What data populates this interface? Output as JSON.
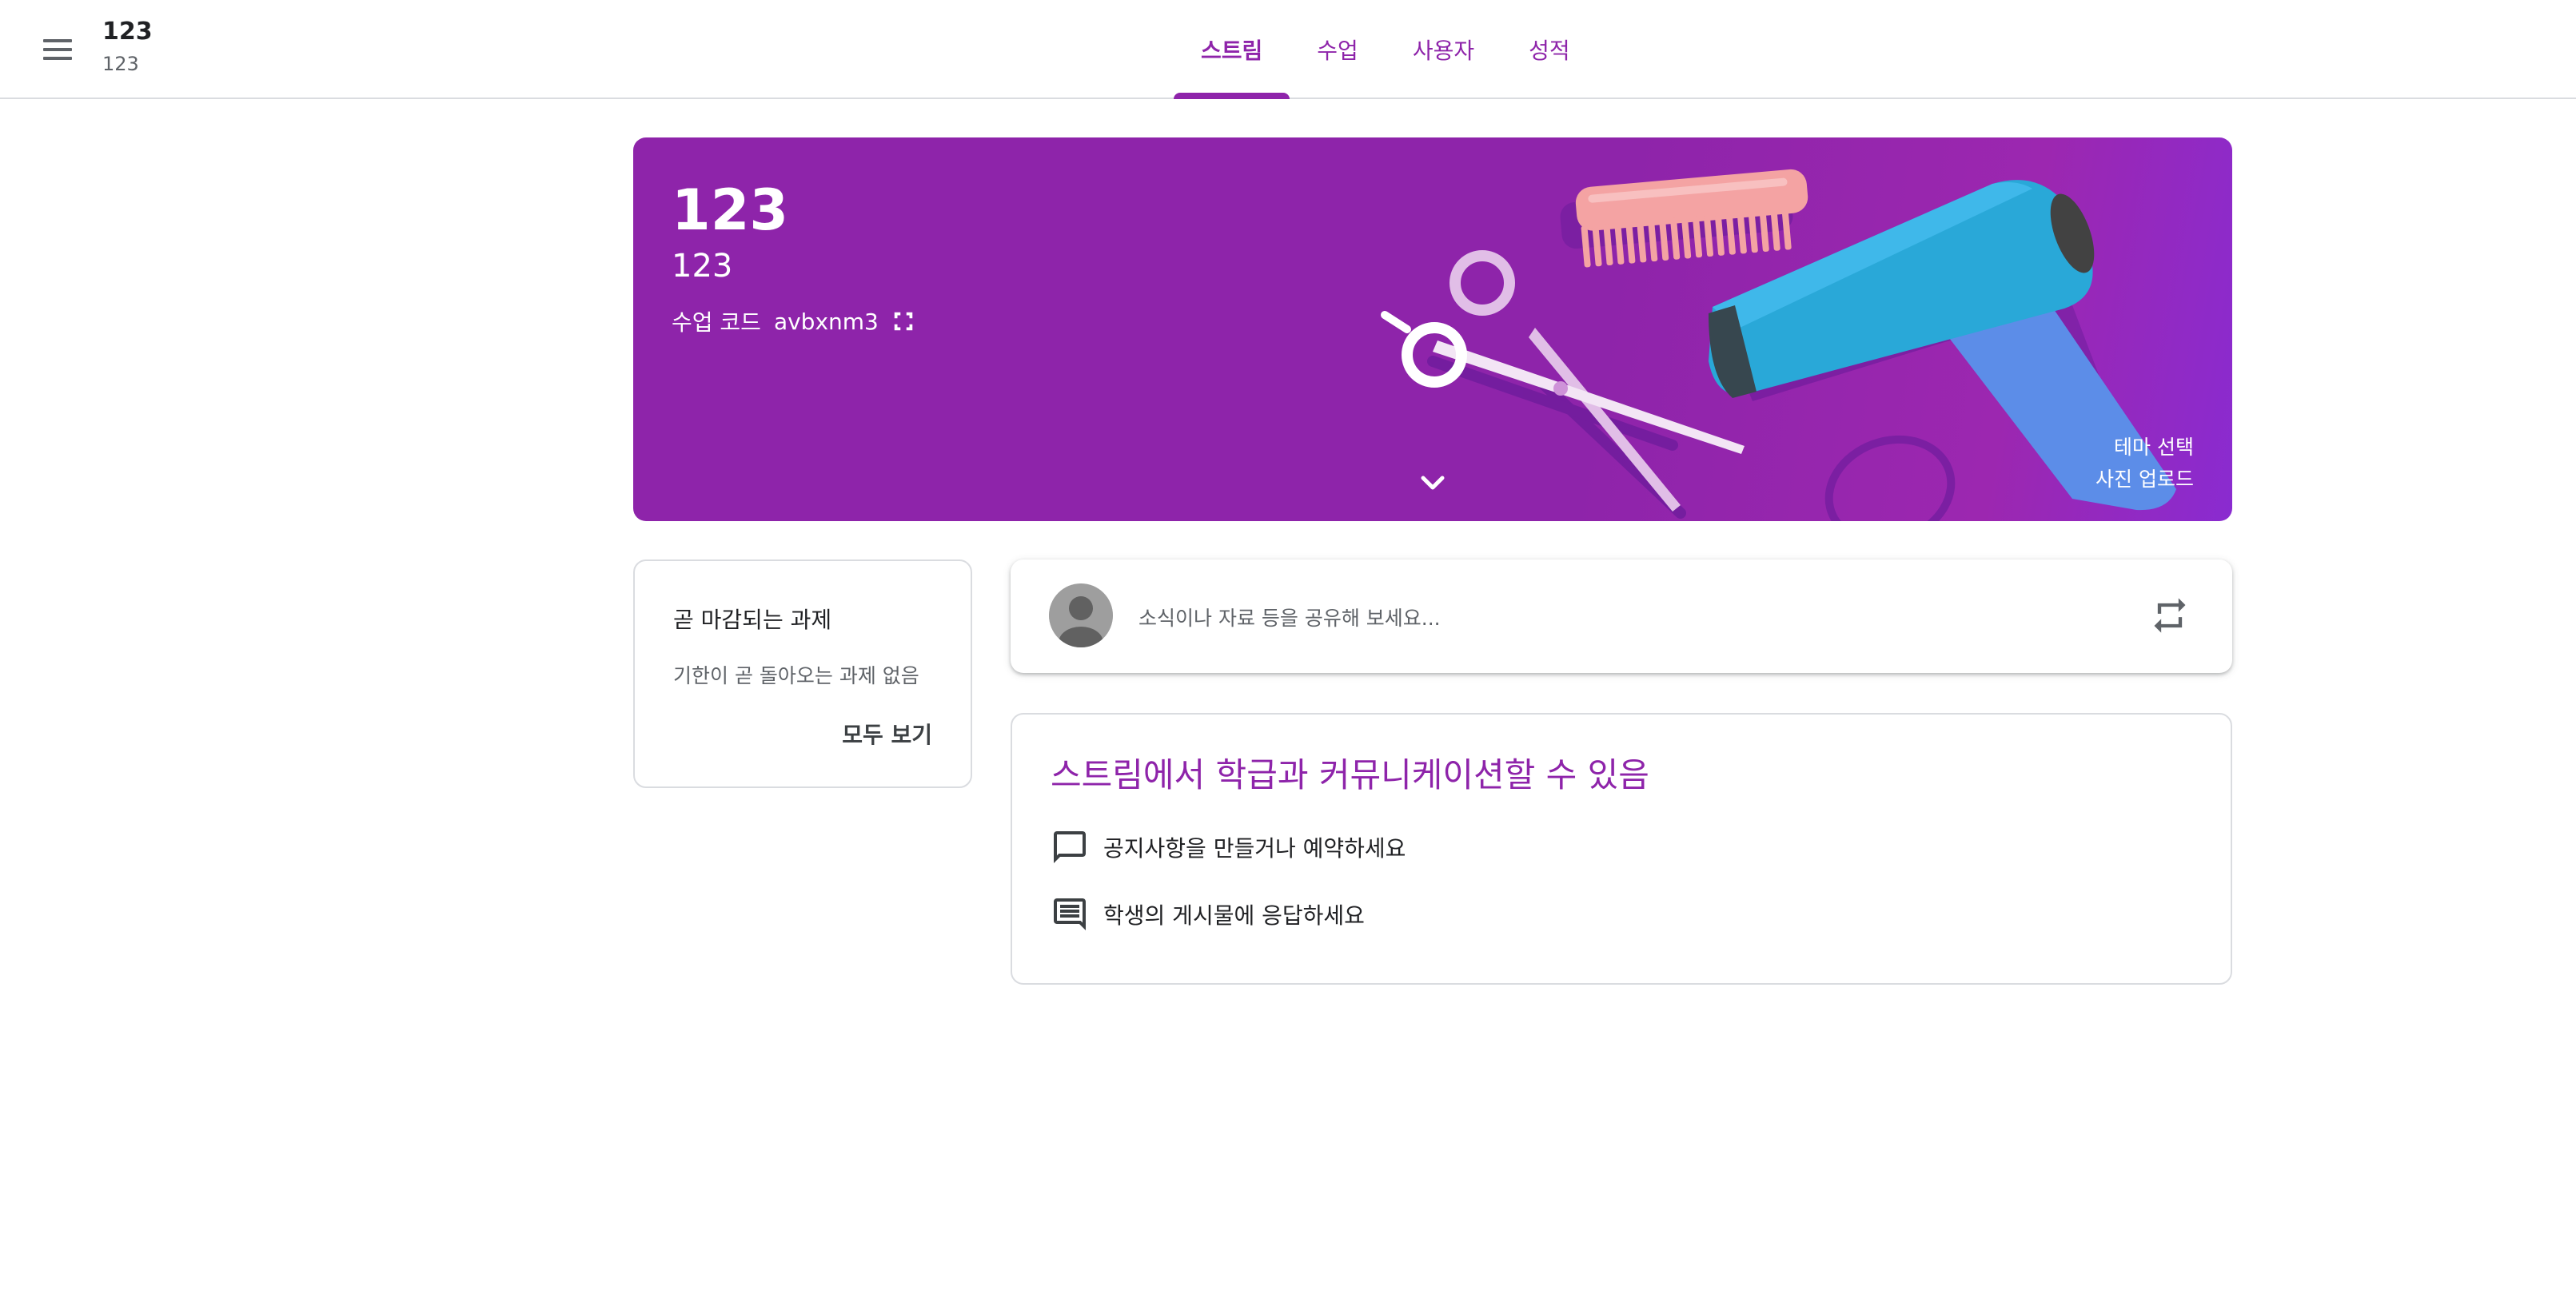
{
  "header": {
    "menu_icon": "hamburger-menu-icon",
    "class_name": "123",
    "class_section": "123",
    "tabs": [
      {
        "label": "스트림",
        "active": true
      },
      {
        "label": "수업",
        "active": false
      },
      {
        "label": "사용자",
        "active": false
      },
      {
        "label": "성적",
        "active": false
      }
    ]
  },
  "banner": {
    "title": "123",
    "subtitle": "123",
    "code_label": "수업 코드",
    "code_value": "avbxnm3",
    "fullscreen_icon": "fullscreen-icon",
    "expand_icon": "chevron-down-icon",
    "theme_link": "테마 선택",
    "upload_link": "사진 업로드",
    "color": "#8e24aa"
  },
  "upcoming": {
    "title": "곧 마감되는 과제",
    "empty_text": "기한이 곧 돌아오는 과제 없음",
    "view_all": "모두 보기"
  },
  "share": {
    "placeholder": "소식이나 자료 등을 공유해 보세요...",
    "avatar_icon": "default-avatar-icon",
    "repost_icon": "repost-icon"
  },
  "info": {
    "title": "스트림에서 학급과 커뮤니케이션할 수 있음",
    "items": [
      {
        "icon": "chat-bubble-icon",
        "text": "공지사항을 만들거나 예약하세요"
      },
      {
        "icon": "comment-lines-icon",
        "text": "학생의 게시물에 응답하세요"
      }
    ]
  },
  "colors": {
    "accent": "#8e24aa",
    "hair_dryer": "#29a8d8",
    "comb": "#f4a3a3"
  }
}
